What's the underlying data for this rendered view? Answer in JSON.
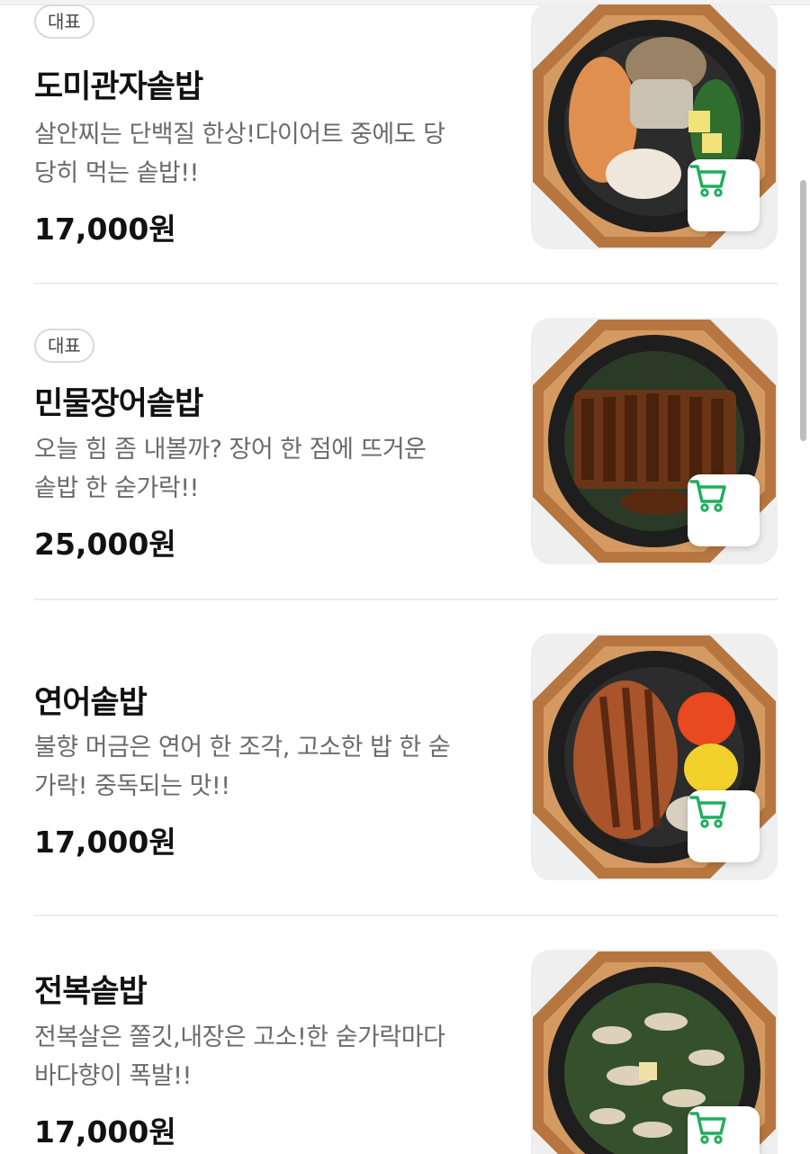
{
  "menu": {
    "items": [
      {
        "badge": "대표",
        "name": "도미관자솥밥",
        "desc_line1": "살안찌는 단백질 한상!다이어트 중에도 당",
        "desc_line2": "당히 먹는 솥밥!!",
        "price": "17,000원",
        "dish": "domi-gwanja"
      },
      {
        "badge": "대표",
        "name": "민물장어솥밥",
        "desc_line1": "오늘 힘 좀 내볼까? 장어 한 점에 뜨거운",
        "desc_line2": "솥밥 한 숟가락!!",
        "price": "25,000원",
        "dish": "eel"
      },
      {
        "badge": "",
        "name": "연어솥밥",
        "desc_line1": "불향 머금은 연어 한 조각, 고소한 밥 한 숟",
        "desc_line2": "가락! 중독되는 맛!!",
        "price": "17,000원",
        "dish": "salmon"
      },
      {
        "badge": "",
        "name": "전복솥밥",
        "desc_line1": "전복살은 쫄깃,내장은 고소!한 숟가락마다",
        "desc_line2": "바다향이 폭발!!",
        "price": "17,000원",
        "dish": "abalone"
      }
    ]
  },
  "icons": {
    "cart": "shopping-cart-icon"
  },
  "colors": {
    "cart_accent": "#1fae5b",
    "price": "#111111",
    "description": "#6b6b6b"
  }
}
